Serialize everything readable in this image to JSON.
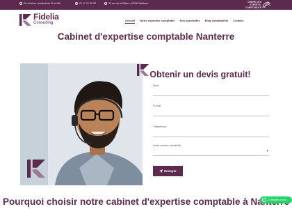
{
  "topbar": {
    "hours": "Du lundi au vendredi de 9h à 18h",
    "phone": "01 47 21 50 33",
    "address": "35 rue de la Pâture, 92000 Nanterre",
    "ordre": "ORDRE DES EXPERTS-COMPTABLES"
  },
  "header": {
    "logo_name": "Fidelia",
    "logo_sub": "Consulting",
    "nav": [
      "Accueil",
      "Notre expertise comptable",
      "Nos spécialités",
      "Blog comptabilité",
      "Contact"
    ]
  },
  "page_title": "Cabinet d'expertise comptable Nanterre",
  "form": {
    "title": "Obtenir un devis gratuit!",
    "fields": [
      "Nom",
      "E-mail",
      "Téléphone",
      "Votre secteur d'activité"
    ],
    "submit": "Envoyer"
  },
  "section_title": "Pourquoi choisir notre cabinet d'expertise comptable à Nanterre ?",
  "whatsapp": "Contactez-nous",
  "colors": {
    "brand": "#5b2a4e",
    "whatsapp": "#25d366"
  }
}
